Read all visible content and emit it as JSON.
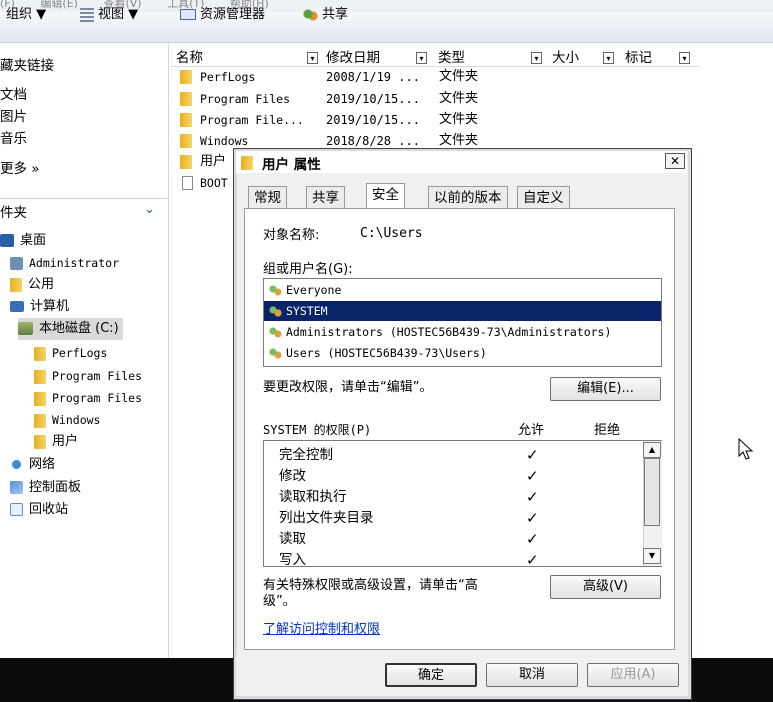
{
  "menubar": {
    "items": [
      "(F)",
      "编辑(E)",
      "查看(V)",
      "工具(T)",
      "帮助(H)"
    ]
  },
  "toolbar": {
    "organize": "组织 ▼",
    "view": "视图 ▼",
    "explorer": "资源管理器",
    "share": "共享"
  },
  "nav": {
    "favorites_header": "藏夹链接",
    "favorites": [
      "文档",
      "图片",
      "音乐"
    ],
    "more": "更多 »",
    "folders_header": "件夹",
    "tree": [
      {
        "label": "桌面",
        "mono": false
      },
      {
        "label": "Administrator",
        "mono": true
      },
      {
        "label": "公用",
        "mono": false
      },
      {
        "label": "计算机",
        "mono": false
      },
      {
        "label": "本地磁盘 (C:)",
        "mono": false
      },
      {
        "label": "PerfLogs",
        "mono": true
      },
      {
        "label": "Program Files",
        "mono": true
      },
      {
        "label": "Program Files",
        "mono": true
      },
      {
        "label": "Windows",
        "mono": true
      },
      {
        "label": "用户",
        "mono": false
      },
      {
        "label": "网络",
        "mono": false
      },
      {
        "label": "控制面板",
        "mono": false
      },
      {
        "label": "回收站",
        "mono": false
      }
    ]
  },
  "filelist": {
    "columns": [
      "名称",
      "修改日期",
      "类型",
      "大小",
      "标记"
    ],
    "rows": [
      {
        "name": "PerfLogs",
        "date": "2008/1/19 ...",
        "type": "文件夹"
      },
      {
        "name": "Program Files",
        "date": "2019/10/15...",
        "type": "文件夹"
      },
      {
        "name": "Program File...",
        "date": "2019/10/15...",
        "type": "文件夹"
      },
      {
        "name": "Windows",
        "date": "2018/8/28 ...",
        "type": "文件夹"
      },
      {
        "name": "用户",
        "date": "",
        "type": ""
      },
      {
        "name": "BOOT",
        "date": "",
        "type": ""
      }
    ]
  },
  "dialog": {
    "title": "用户 属性",
    "close": "✕",
    "tabs": [
      "常规",
      "共享",
      "安全",
      "以前的版本",
      "自定义"
    ],
    "object_label": "对象名称:",
    "object_value": "C:\\Users",
    "group_label": "组或用户名(G):",
    "users": [
      "Everyone",
      "SYSTEM",
      "Administrators (HOSTEC56B439-73\\Administrators)",
      "Users (HOSTEC56B439-73\\Users)"
    ],
    "edit_hint": "要更改权限，请单击“编辑”。",
    "edit_button": "编辑(E)...",
    "perm_header": "SYSTEM 的权限(P)",
    "allow_header": "允许",
    "deny_header": "拒绝",
    "permissions": [
      "完全控制",
      "修改",
      "读取和执行",
      "列出文件夹目录",
      "读取",
      "写入"
    ],
    "check": "✓",
    "advanced_hint_1": "有关特殊权限或高级设置，请单击“高",
    "advanced_hint_2": "级”。",
    "advanced_button": "高级(V)",
    "learn_link": "了解访问控制和权限",
    "ok": "确定",
    "cancel": "取消",
    "apply": "应用(A)"
  }
}
